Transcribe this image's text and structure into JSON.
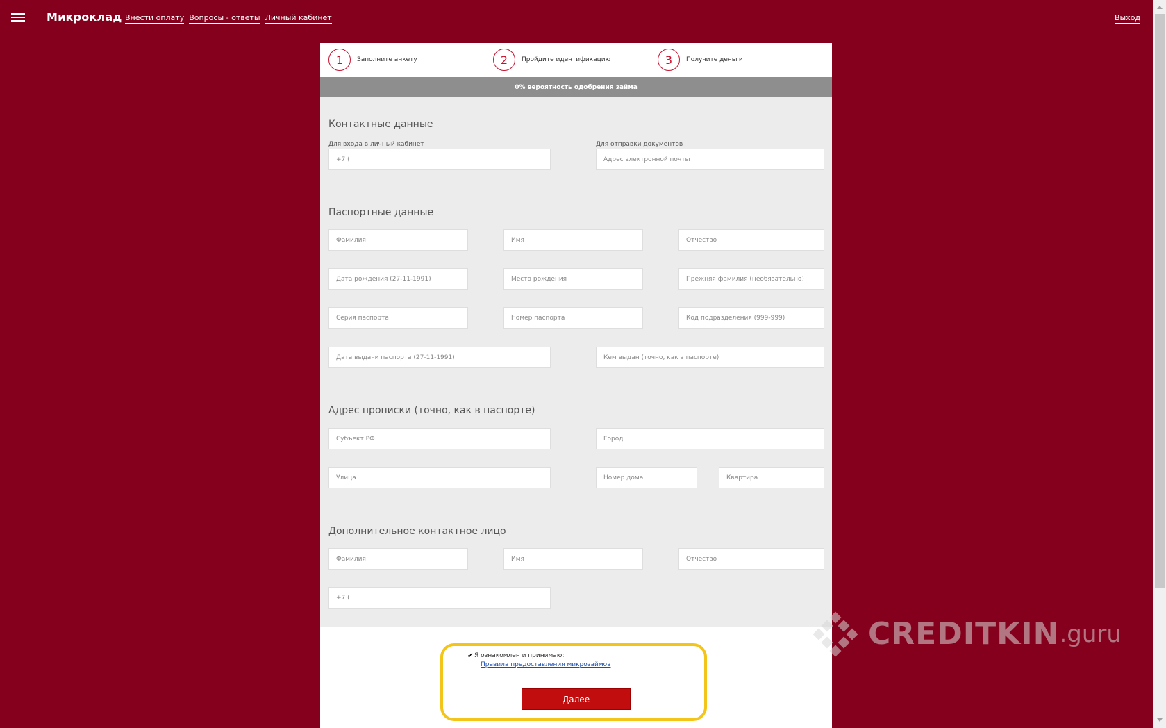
{
  "header": {
    "logo": "Микроклад",
    "nav": [
      {
        "label": "Внести оплату"
      },
      {
        "label": "Вопросы - ответы"
      },
      {
        "label": "Личный кабинет"
      }
    ],
    "logout": "Выход"
  },
  "steps": [
    {
      "num": "1",
      "label": "Заполните анкету"
    },
    {
      "num": "2",
      "label": "Пройдите идентификацию"
    },
    {
      "num": "3",
      "label": "Получите деньги"
    }
  ],
  "probability": "0% вероятность одобрения займа",
  "contact": {
    "title": "Контактные данные",
    "phone_label": "Для входа в личный кабинет",
    "phone_value": "+7 (",
    "email_label": "Для отправки документов",
    "email_placeholder": "Адрес электронной почты"
  },
  "passport": {
    "title": "Паспортные данные",
    "surname": "Фамилия",
    "name": "Имя",
    "patronymic": "Отчество",
    "birth_date": "Дата рождения (27-11-1991)",
    "birth_place": "Место рождения",
    "prev_surname": "Прежняя фамилия (необязательно)",
    "series": "Серия паспорта",
    "number": "Номер паспорта",
    "dept_code": "Код подразделения (999-999)",
    "issue_date": "Дата выдачи паспорта (27-11-1991)",
    "issued_by": "Кем выдан (точно, как в паспорте)"
  },
  "address": {
    "title": "Адрес прописки (точно, как в паспорте)",
    "region": "Субъект РФ",
    "city": "Город",
    "street": "Улица",
    "house": "Номер дома",
    "flat": "Квартира"
  },
  "extra_contact": {
    "title": "Дополнительное контактное лицо",
    "surname": "Фамилия",
    "name": "Имя",
    "patronymic": "Отчество",
    "phone_value": "+7 ("
  },
  "agreement": {
    "checked": true,
    "text": "Я ознакомлен и принимаю:",
    "link": "Правила предоставления микрозаймов"
  },
  "next_button": "Далее",
  "watermark": {
    "brand": "CREDITKIN",
    "suffix": ".guru"
  },
  "colors": {
    "background": "#84001c",
    "accent": "#c10d0d",
    "highlight": "#f3c51b"
  }
}
